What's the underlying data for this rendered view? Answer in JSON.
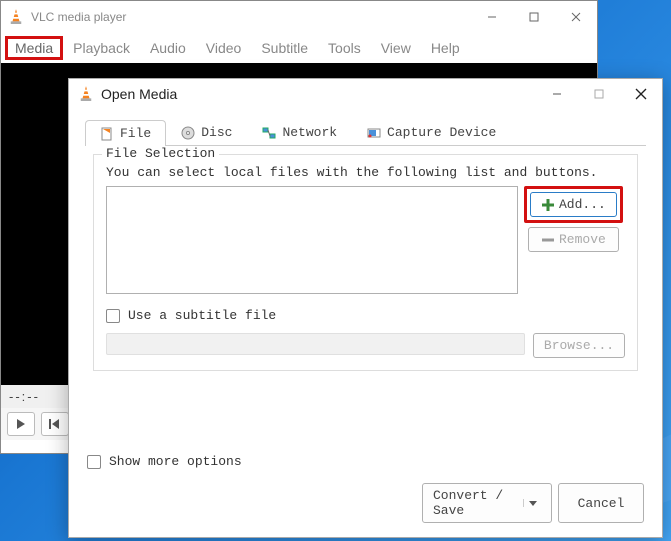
{
  "vlc": {
    "title": "VLC media player",
    "menu": {
      "media": "Media",
      "playback": "Playback",
      "audio": "Audio",
      "video": "Video",
      "subtitle": "Subtitle",
      "tools": "Tools",
      "view": "View",
      "help": "Help"
    },
    "time": "--:--"
  },
  "open_media": {
    "title": "Open Media",
    "tabs": {
      "file": "File",
      "disc": "Disc",
      "network": "Network",
      "capture": "Capture Device"
    },
    "file_section": {
      "legend": "File Selection",
      "hint": "You can select local files with the following list and buttons.",
      "add": "Add...",
      "remove": "Remove"
    },
    "subtitle": {
      "label": "Use a subtitle file",
      "browse": "Browse..."
    },
    "show_more": "Show more options",
    "convert": "Convert / Save",
    "cancel": "Cancel"
  }
}
